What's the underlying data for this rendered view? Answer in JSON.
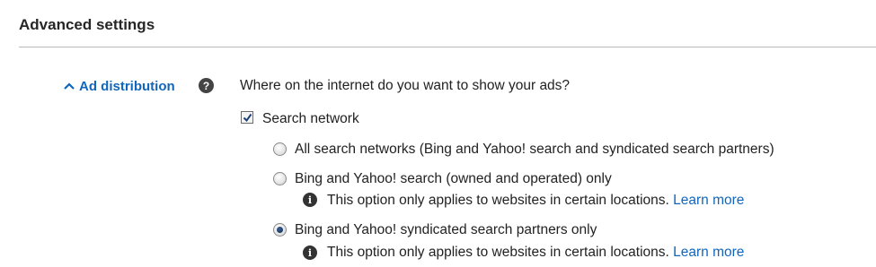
{
  "section": {
    "title": "Advanced settings"
  },
  "ad_distribution": {
    "label": "Ad distribution",
    "help_icon": "question-circle-icon",
    "help_glyph": "?",
    "question": "Where on the internet do you want to show your ads?"
  },
  "search_network": {
    "label": "Search network",
    "checked": true,
    "options": [
      {
        "label": "All search networks (Bing and Yahoo! search and syndicated search partners)",
        "selected": false
      },
      {
        "label": "Bing and Yahoo! search (owned and operated) only",
        "selected": false,
        "note": "This option only applies to websites in certain locations.",
        "note_link": "Learn more"
      },
      {
        "label": "Bing and Yahoo! syndicated search partners only",
        "selected": true,
        "note": "This option only applies to websites in certain locations.",
        "note_link": "Learn more"
      }
    ]
  },
  "info_glyph": "i",
  "colors": {
    "link": "#1166bb",
    "divider": "#b8b8b8",
    "text": "#222222"
  }
}
